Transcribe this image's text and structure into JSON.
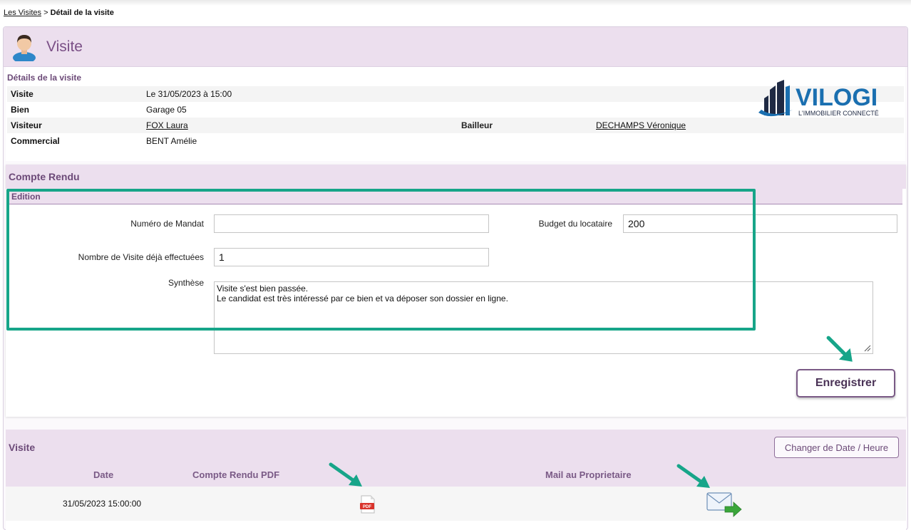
{
  "breadcrumb": {
    "parent": "Les Visites",
    "separator": ">",
    "current": "Détail de la visite"
  },
  "header": {
    "title": "Visite",
    "icon": "user-avatar-icon"
  },
  "details": {
    "section_title": "Détails de la visite",
    "rows": {
      "visite": {
        "label": "Visite",
        "value": "Le 31/05/2023 à 15:00"
      },
      "bien": {
        "label": "Bien",
        "value": "Garage 05"
      },
      "visiteur": {
        "label": "Visiteur",
        "value": "FOX Laura"
      },
      "bailleur": {
        "label": "Bailleur",
        "value": "DECHAMPS Véronique"
      },
      "commercial": {
        "label": "Commercial",
        "value": "BENT Amélie"
      }
    }
  },
  "logo": {
    "name": "VILOGI",
    "tagline": "L'IMMOBILIER CONNECTÉ"
  },
  "compte_rendu": {
    "title": "Compte Rendu",
    "edition_label": "Edition",
    "fields": {
      "mandat": {
        "label": "Numéro de Mandat",
        "value": ""
      },
      "budget": {
        "label": "Budget du locataire",
        "value": "200"
      },
      "nb_visites": {
        "label": "Nombre de Visite déjà effectuées",
        "value": "1"
      },
      "synthese": {
        "label": "Synthèse",
        "value": "Visite s'est bien passée.\nLe candidat est très intéressé par ce bien et va déposer son dossier en ligne."
      }
    },
    "save_label": "Enregistrer"
  },
  "visit_table": {
    "title": "Visite",
    "change_button": "Changer de Date / Heure",
    "columns": {
      "date": "Date",
      "pdf": "Compte Rendu PDF",
      "mail": "Mail au Proprietaire"
    },
    "rows": [
      {
        "date": "31/05/2023 15:00:00",
        "pdf_icon": "pdf-icon",
        "mail_icon": "mail-send-icon"
      }
    ]
  },
  "colors": {
    "accent": "#6c4a78",
    "header_bg": "#ecdfee",
    "highlight": "#17a589",
    "logo_blue": "#1a6fb0"
  }
}
